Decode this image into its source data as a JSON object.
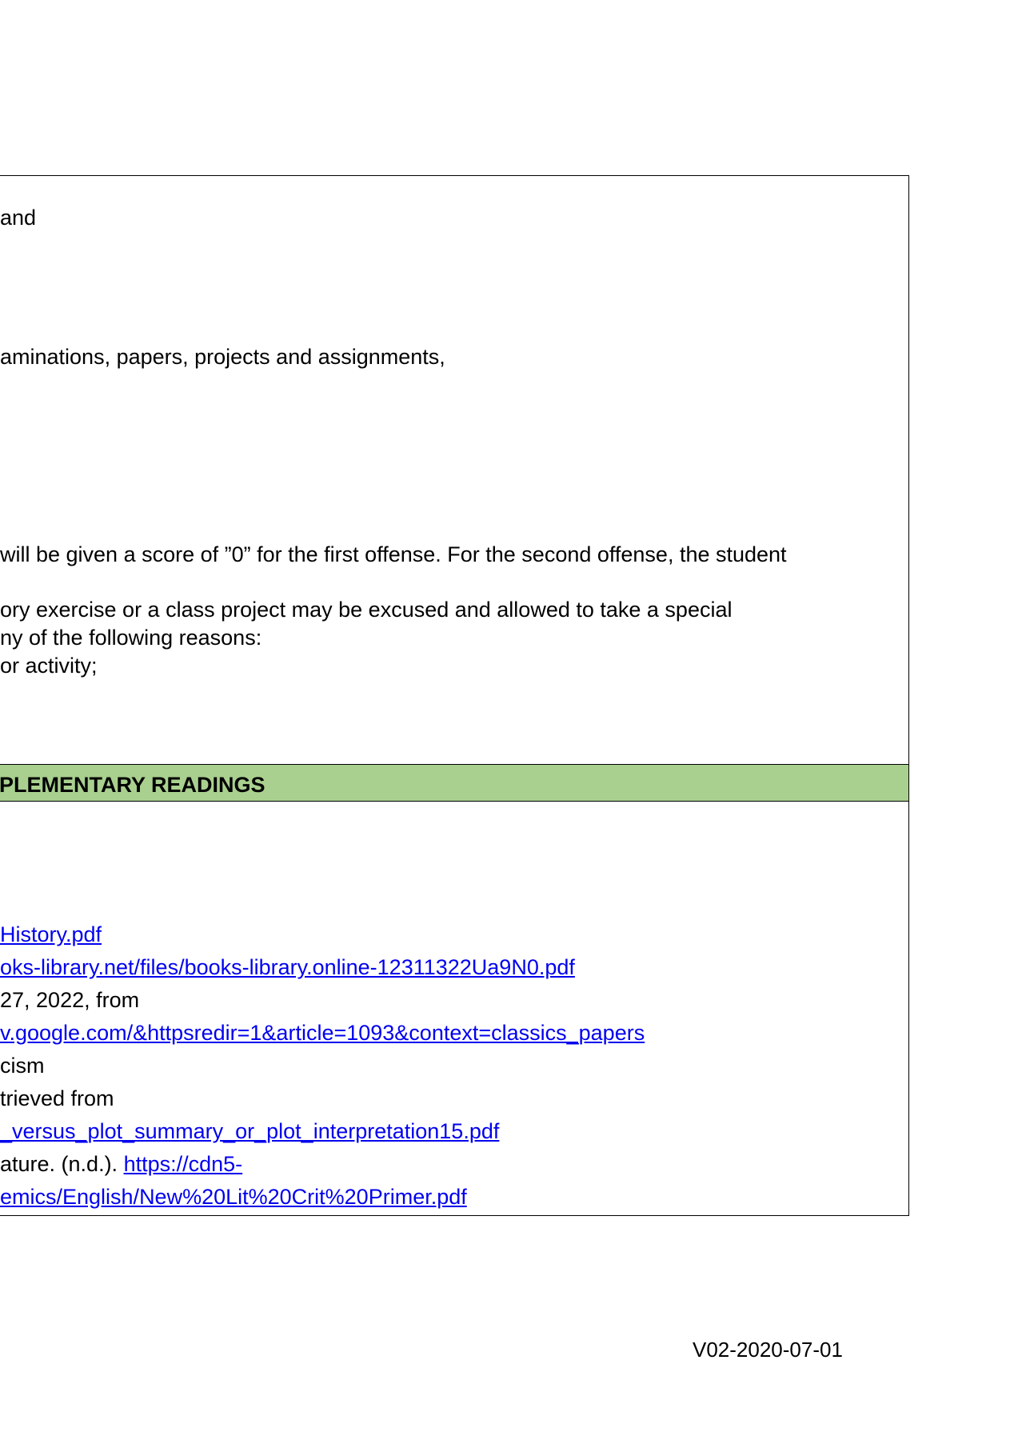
{
  "policies": {
    "lines": [
      "and",
      "aminations, papers, projects and assignments,",
      " will be given a score of ”0” for the first offense. For the second offense, the student",
      "ory exercise or a class project may be excused and allowed to take a special",
      "ny of the following reasons:",
      "or activity;"
    ]
  },
  "readings": {
    "header": "PLEMENTARY READINGS",
    "line1_link": "History.pdf",
    "line2_link": "oks-library.net/files/books-library.online-12311322Ua9N0.pdf",
    "line3_text": " 27, 2022, from",
    "line4_link": "v.google.com/&httpsredir=1&article=1093&context=classics_papers",
    "line5_text": "cism",
    "line6_text": "trieved from",
    "line7_link": "_versus_plot_summary_or_plot_interpretation15.pdf",
    "line8_text": "ature. (n.d.). ",
    "line8_link": "https://cdn5-",
    "line9_link": "emics/English/New%20Lit%20Crit%20Primer.pdf"
  },
  "footer": {
    "version": "V02-2020-07-01"
  }
}
